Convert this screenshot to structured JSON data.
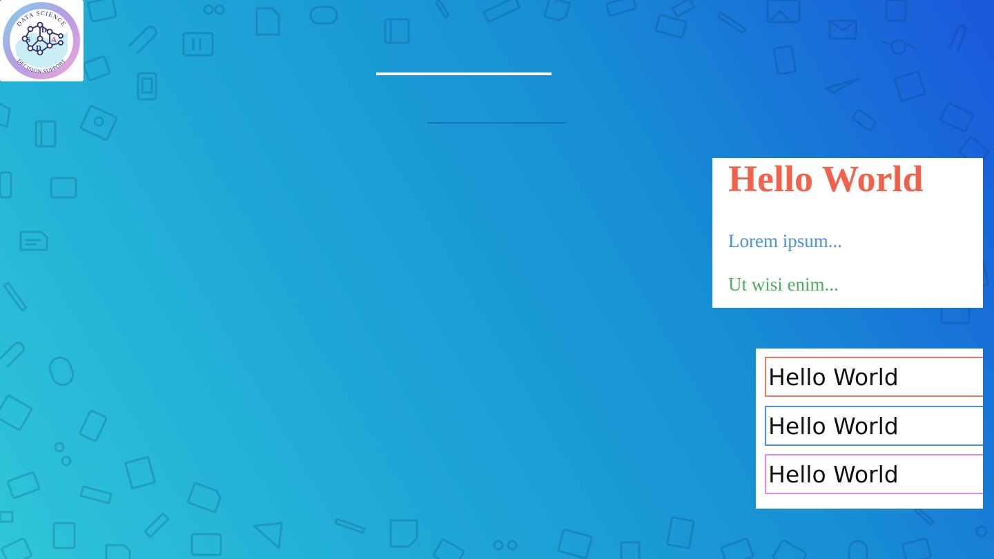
{
  "logo": {
    "top_text": "DATA SCIENCE",
    "bottom_text": "DECISION SUPPORT",
    "letters": [
      "S",
      "D",
      "D",
      "A"
    ]
  },
  "preview": {
    "heading": "Hello World",
    "paragraph_1": "Lorem ipsum...",
    "paragraph_2": "Ut wisi enim..."
  },
  "inputs": [
    {
      "value": "Hello World",
      "border_color": "#f2755e"
    },
    {
      "value": "Hello World",
      "border_color": "#4a90e8"
    },
    {
      "value": "Hello World",
      "border_color": "#e48ae6"
    }
  ],
  "colors": {
    "heading": "#f2614a",
    "paragraph_1": "#4a8ee8",
    "paragraph_2": "#4bae5e",
    "background_start": "#2ec6d8",
    "background_end": "#1a57dc"
  }
}
